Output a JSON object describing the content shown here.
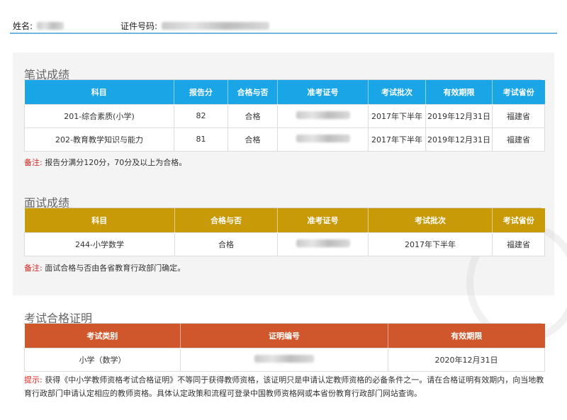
{
  "header": {
    "name_label": "姓名:",
    "id_label": "证件号码:"
  },
  "written": {
    "title": "笔试成绩",
    "columns": [
      "科目",
      "报告分",
      "合格与否",
      "准考证号",
      "考试批次",
      "有效期限",
      "考试省份"
    ],
    "rows": [
      {
        "subject": "201-综合素质(小学)",
        "score": "82",
        "pass": "合格",
        "batch": "2017年下半年",
        "valid": "2019年12月31日",
        "province": "福建省"
      },
      {
        "subject": "202-教育教学知识与能力",
        "score": "81",
        "pass": "合格",
        "batch": "2017年下半年",
        "valid": "2019年12月31日",
        "province": "福建省"
      }
    ],
    "note_label": "备注:",
    "note_text": "报告分满分120分，70分及以上为合格。"
  },
  "interview": {
    "title": "面试成绩",
    "columns": [
      "科目",
      "合格与否",
      "准考证号",
      "考试批次",
      "考试省份"
    ],
    "rows": [
      {
        "subject": "244-小学数学",
        "pass": "合格",
        "batch": "2017年下半年",
        "province": "福建省"
      }
    ],
    "note_label": "备注:",
    "note_text": "面试合格与否由各省教育行政部门确定。"
  },
  "certificate": {
    "title": "考试合格证明",
    "columns": [
      "考试类别",
      "证明编号",
      "有效期限"
    ],
    "rows": [
      {
        "category": "小学（数学）",
        "valid": "2020年12月31日"
      }
    ],
    "tip_label": "提示:",
    "tip_text": "获得《中小学教师资格考试合格证明》不等同于获得教师资格，该证明只是申请认定教师资格的必备条件之一。请在合格证明有效期内，向当地教育行政部门申请认定相应的教师资格。具体认定政策和流程可登录中国教师资格网或本省份教育行政部门网站查询。"
  },
  "colors": {
    "written_header": "#1aa6e6",
    "interview_header": "#c99a07",
    "certificate_header": "#d0572b",
    "note_label": "#d6241c"
  }
}
